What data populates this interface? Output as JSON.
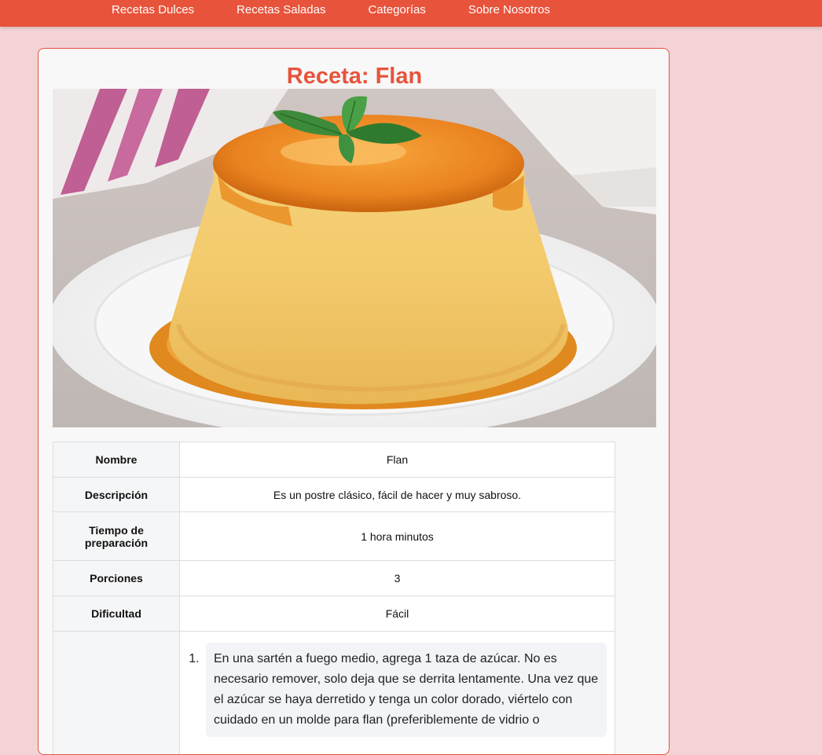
{
  "nav": {
    "items": [
      "Recetas Dulces",
      "Recetas Saladas",
      "Categorías",
      "Sobre Nosotros"
    ]
  },
  "recipe": {
    "title": "Receta: Flan",
    "image_icon": "flan-photo",
    "rows": [
      {
        "label": "Nombre",
        "value": "Flan"
      },
      {
        "label": "Descripción",
        "value": "Es un postre clásico, fácil de hacer y muy sabroso."
      },
      {
        "label": "Tiempo de preparación",
        "value": "1 hora minutos"
      },
      {
        "label": "Porciones",
        "value": "3"
      },
      {
        "label": "Dificultad",
        "value": "Fácil"
      }
    ],
    "steps": [
      "En una sartén a fuego medio, agrega 1 taza de azúcar. No es necesario remover, solo deja que se derrita lentamente. Una vez que el azúcar se haya derretido y tenga un color dorado, viértelo con cuidado en un molde para flan (preferiblemente de vidrio o"
    ]
  },
  "colors": {
    "accent": "#e8533b",
    "page_bg": "#f4d3d6",
    "card_bg": "#f8f8f8"
  }
}
